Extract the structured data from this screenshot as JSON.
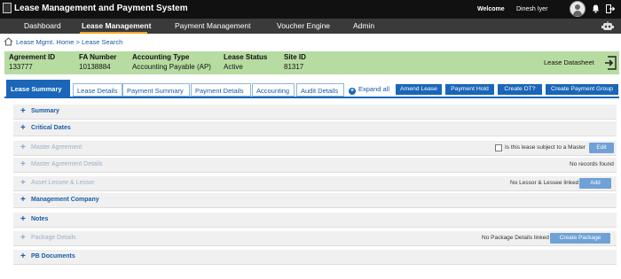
{
  "app": {
    "title": "Lease Management and Payment System"
  },
  "header": {
    "welcome": "Welcome",
    "user": "Dinesh Iyer"
  },
  "nav": {
    "items": [
      {
        "label": "Dashboard"
      },
      {
        "label": "Lease Management"
      },
      {
        "label": "Payment Management"
      },
      {
        "label": "Voucher Engine"
      },
      {
        "label": "Admin"
      }
    ],
    "active": "Lease Management"
  },
  "breadcrumb": {
    "text": "Lease Mgmt. Home > Lease Search"
  },
  "info": {
    "fields": [
      {
        "label": "Agreement ID",
        "value": "133777"
      },
      {
        "label": "FA Number",
        "value": "10138884"
      },
      {
        "label": "Accounting Type",
        "value": "Accounting Payable (AP)"
      },
      {
        "label": "Lease Status",
        "value": "Active"
      },
      {
        "label": "Site ID",
        "value": "81317"
      }
    ],
    "datasheet_label": "Lease Datasheet"
  },
  "tabs": [
    {
      "label": "Lease Summary"
    },
    {
      "label": "Lease Details"
    },
    {
      "label": "Payment Summary"
    },
    {
      "label": "Payment Details"
    },
    {
      "label": "Accounting"
    },
    {
      "label": "Audit Details"
    }
  ],
  "expand_all": "Expand all",
  "actions": [
    {
      "label": "Amend Lease"
    },
    {
      "label": "Payment Hold"
    },
    {
      "label": "Create DT?"
    },
    {
      "label": "Create Payment Group"
    }
  ],
  "sections": [
    {
      "title": "Summary",
      "state": "enabled"
    },
    {
      "title": "Critical Dates",
      "state": "enabled"
    },
    {
      "title": "Master Agreement",
      "state": "disabled",
      "checkbox_label": "Is this lease subject to a Master",
      "button": "Edit"
    },
    {
      "title": "Master Agreement Details",
      "state": "disabled",
      "note": "No records found"
    },
    {
      "title": "Asset Lessee & Lessor",
      "state": "disabled",
      "note": "No Lessor & Lessee linked",
      "button": "Add"
    },
    {
      "title": "Management Company",
      "state": "enabled"
    },
    {
      "title": "Notes",
      "state": "enabled"
    },
    {
      "title": "Package Details",
      "state": "disabled",
      "note": "No Package Details linked",
      "button": "Create Package"
    },
    {
      "title": "PB Documents",
      "state": "enabled"
    }
  ],
  "colors": {
    "titlebar": "#111111",
    "navbar": "#3a3a3a",
    "nav_accent": "#f5a623",
    "info_bar": "#b7dca2",
    "primary": "#1a66b8",
    "link": "#1a5aa8"
  }
}
